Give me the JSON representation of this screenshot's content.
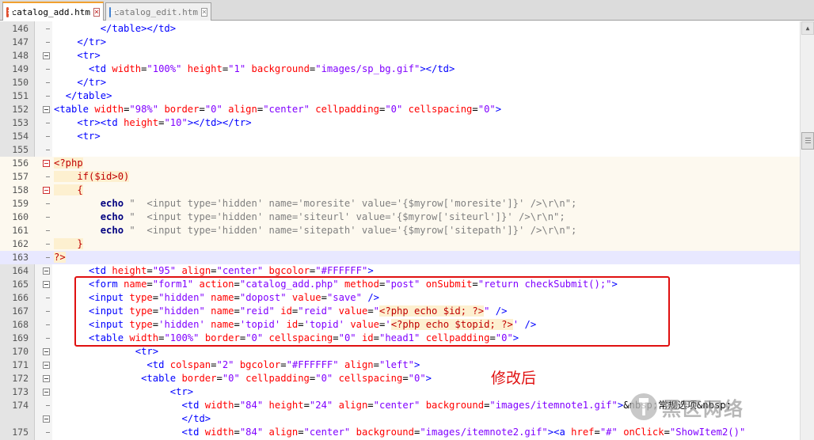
{
  "tabs": [
    {
      "label": "catalog_add.htm",
      "active": true,
      "icon": "file-red-icon",
      "color": "#e05030"
    },
    {
      "label": "catalog_edit.htm",
      "active": false,
      "icon": "file-blue-icon",
      "color": "#4080d0"
    }
  ],
  "annotation": "修改后",
  "watermark": "黑区网络",
  "colors": {
    "tag": "#0000ff",
    "attr": "#ff0000",
    "value": "#8000ff",
    "php": "#c00000",
    "highlight": "#e01010"
  },
  "lines": [
    {
      "n": "146",
      "code": "        </table></td>"
    },
    {
      "n": "147",
      "code": "    </tr>"
    },
    {
      "n": "148",
      "code": "    <tr>"
    },
    {
      "n": "149",
      "code": "      <td width=\"100%\" height=\"1\" background=\"images/sp_bg.gif\"></td>"
    },
    {
      "n": "150",
      "code": "    </tr>"
    },
    {
      "n": "151",
      "code": "  </table>"
    },
    {
      "n": "152",
      "code": "<table width=\"98%\" border=\"0\" align=\"center\" cellpadding=\"0\" cellspacing=\"0\">"
    },
    {
      "n": "153",
      "code": "    <tr><td height=\"10\"></td></tr>"
    },
    {
      "n": "154",
      "code": "    <tr>"
    },
    {
      "n": "155",
      "code": ""
    },
    {
      "n": "156",
      "code": "<?php"
    },
    {
      "n": "157",
      "code": "    if($id>0)"
    },
    {
      "n": "158",
      "code": "    {"
    },
    {
      "n": "159",
      "code": "        echo \"  <input type='hidden' name='moresite' value='{$myrow['moresite']}' />\\r\\n\";"
    },
    {
      "n": "160",
      "code": "        echo \"  <input type='hidden' name='siteurl' value='{$myrow['siteurl']}' />\\r\\n\";"
    },
    {
      "n": "161",
      "code": "        echo \"  <input type='hidden' name='sitepath' value='{$myrow['sitepath']}' />\\r\\n\";"
    },
    {
      "n": "162",
      "code": "    }"
    },
    {
      "n": "163",
      "code": "?>"
    },
    {
      "n": "164",
      "code": "      <td height=\"95\" align=\"center\" bgcolor=\"#FFFFFF\">"
    },
    {
      "n": "165",
      "code": "      <form name=\"form1\" action=\"catalog_add.php\" method=\"post\" onSubmit=\"return checkSubmit();\">"
    },
    {
      "n": "166",
      "code": "      <input type=\"hidden\" name=\"dopost\" value=\"save\" />"
    },
    {
      "n": "167",
      "code": "      <input type=\"hidden\" name=\"reid\" id=\"reid\" value=\"<?php echo $id; ?>\" />"
    },
    {
      "n": "168",
      "code": "      <input type='hidden' name='topid' id='topid' value='<?php echo $topid; ?>' />"
    },
    {
      "n": "169",
      "code": "      <table width=\"100%\" border=\"0\" cellspacing=\"0\" id=\"head1\" cellpadding=\"0\">"
    },
    {
      "n": "170",
      "code": "              <tr>"
    },
    {
      "n": "171",
      "code": "                <td colspan=\"2\" bgcolor=\"#FFFFFF\" align=\"left\">"
    },
    {
      "n": "172",
      "code": "               <table border=\"0\" cellpadding=\"0\" cellspacing=\"0\">"
    },
    {
      "n": "173",
      "code": "                    <tr>"
    },
    {
      "n": "174",
      "code": "                      <td width=\"84\" height=\"24\" align=\"center\" background=\"images/itemnote1.gif\">&nbsp;常规选项&nbsp;"
    },
    {
      "n": "",
      "code": "                      </td>"
    },
    {
      "n": "175",
      "code": "                      <td width=\"84\" align=\"center\" background=\"images/itemnote2.gif\"><a href=\"#\" onClick=\"ShowItem2()\""
    }
  ]
}
